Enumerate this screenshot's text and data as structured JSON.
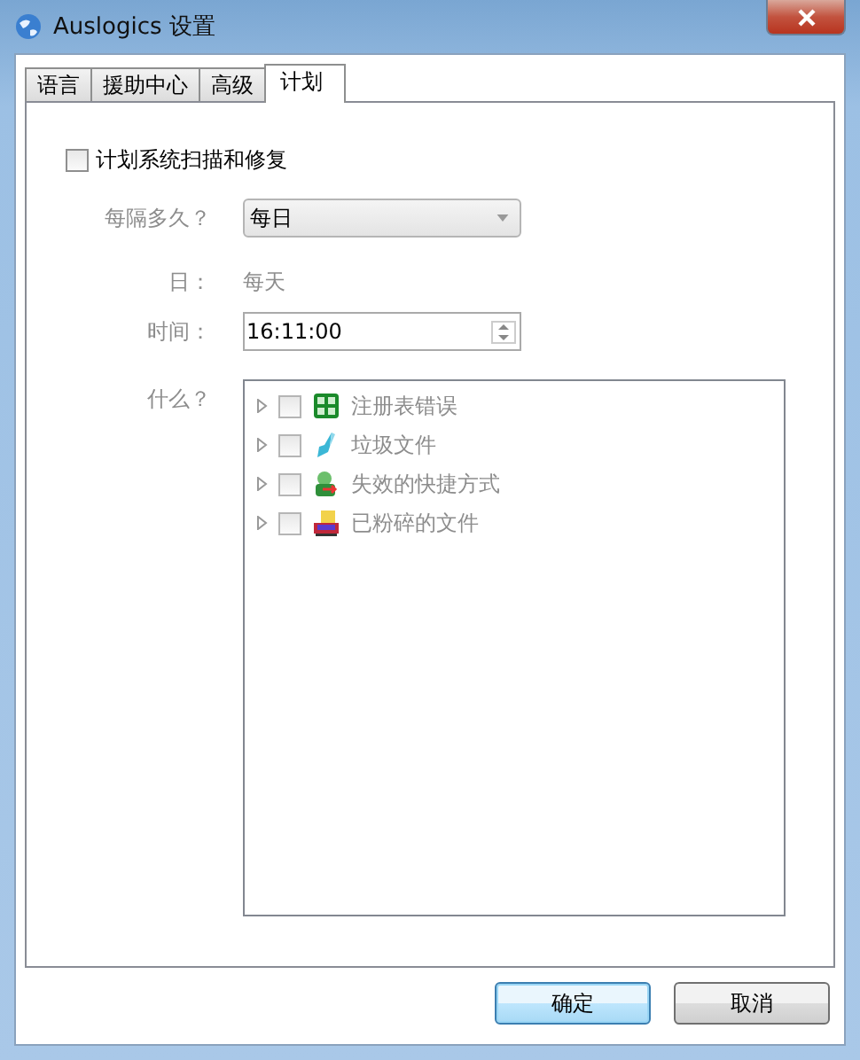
{
  "window": {
    "title": "Auslogics 设置"
  },
  "tabs": [
    {
      "label": "语言",
      "selected": false
    },
    {
      "label": "援助中心",
      "selected": false
    },
    {
      "label": "高级",
      "selected": false
    },
    {
      "label": "计划",
      "selected": true
    }
  ],
  "schedule": {
    "enable_label": "计划系统扫描和修复",
    "checked": false,
    "frequency_label": "每隔多久？",
    "frequency_value": "每日",
    "day_label": "日：",
    "day_value": "每天",
    "time_label": "时间：",
    "time_value": "16:11:00",
    "what_label": "什么？",
    "items": [
      {
        "kind": "registry",
        "label": "注册表错误",
        "checked": false,
        "expanded": false
      },
      {
        "kind": "junk",
        "label": "垃圾文件",
        "checked": false,
        "expanded": false
      },
      {
        "kind": "shortcut",
        "label": "失效的快捷方式",
        "checked": false,
        "expanded": false
      },
      {
        "kind": "shredded",
        "label": "已粉碎的文件",
        "checked": false,
        "expanded": false
      }
    ]
  },
  "buttons": [
    {
      "label": "确定",
      "kind": "default"
    },
    {
      "label": "取消",
      "kind": "normal"
    }
  ]
}
